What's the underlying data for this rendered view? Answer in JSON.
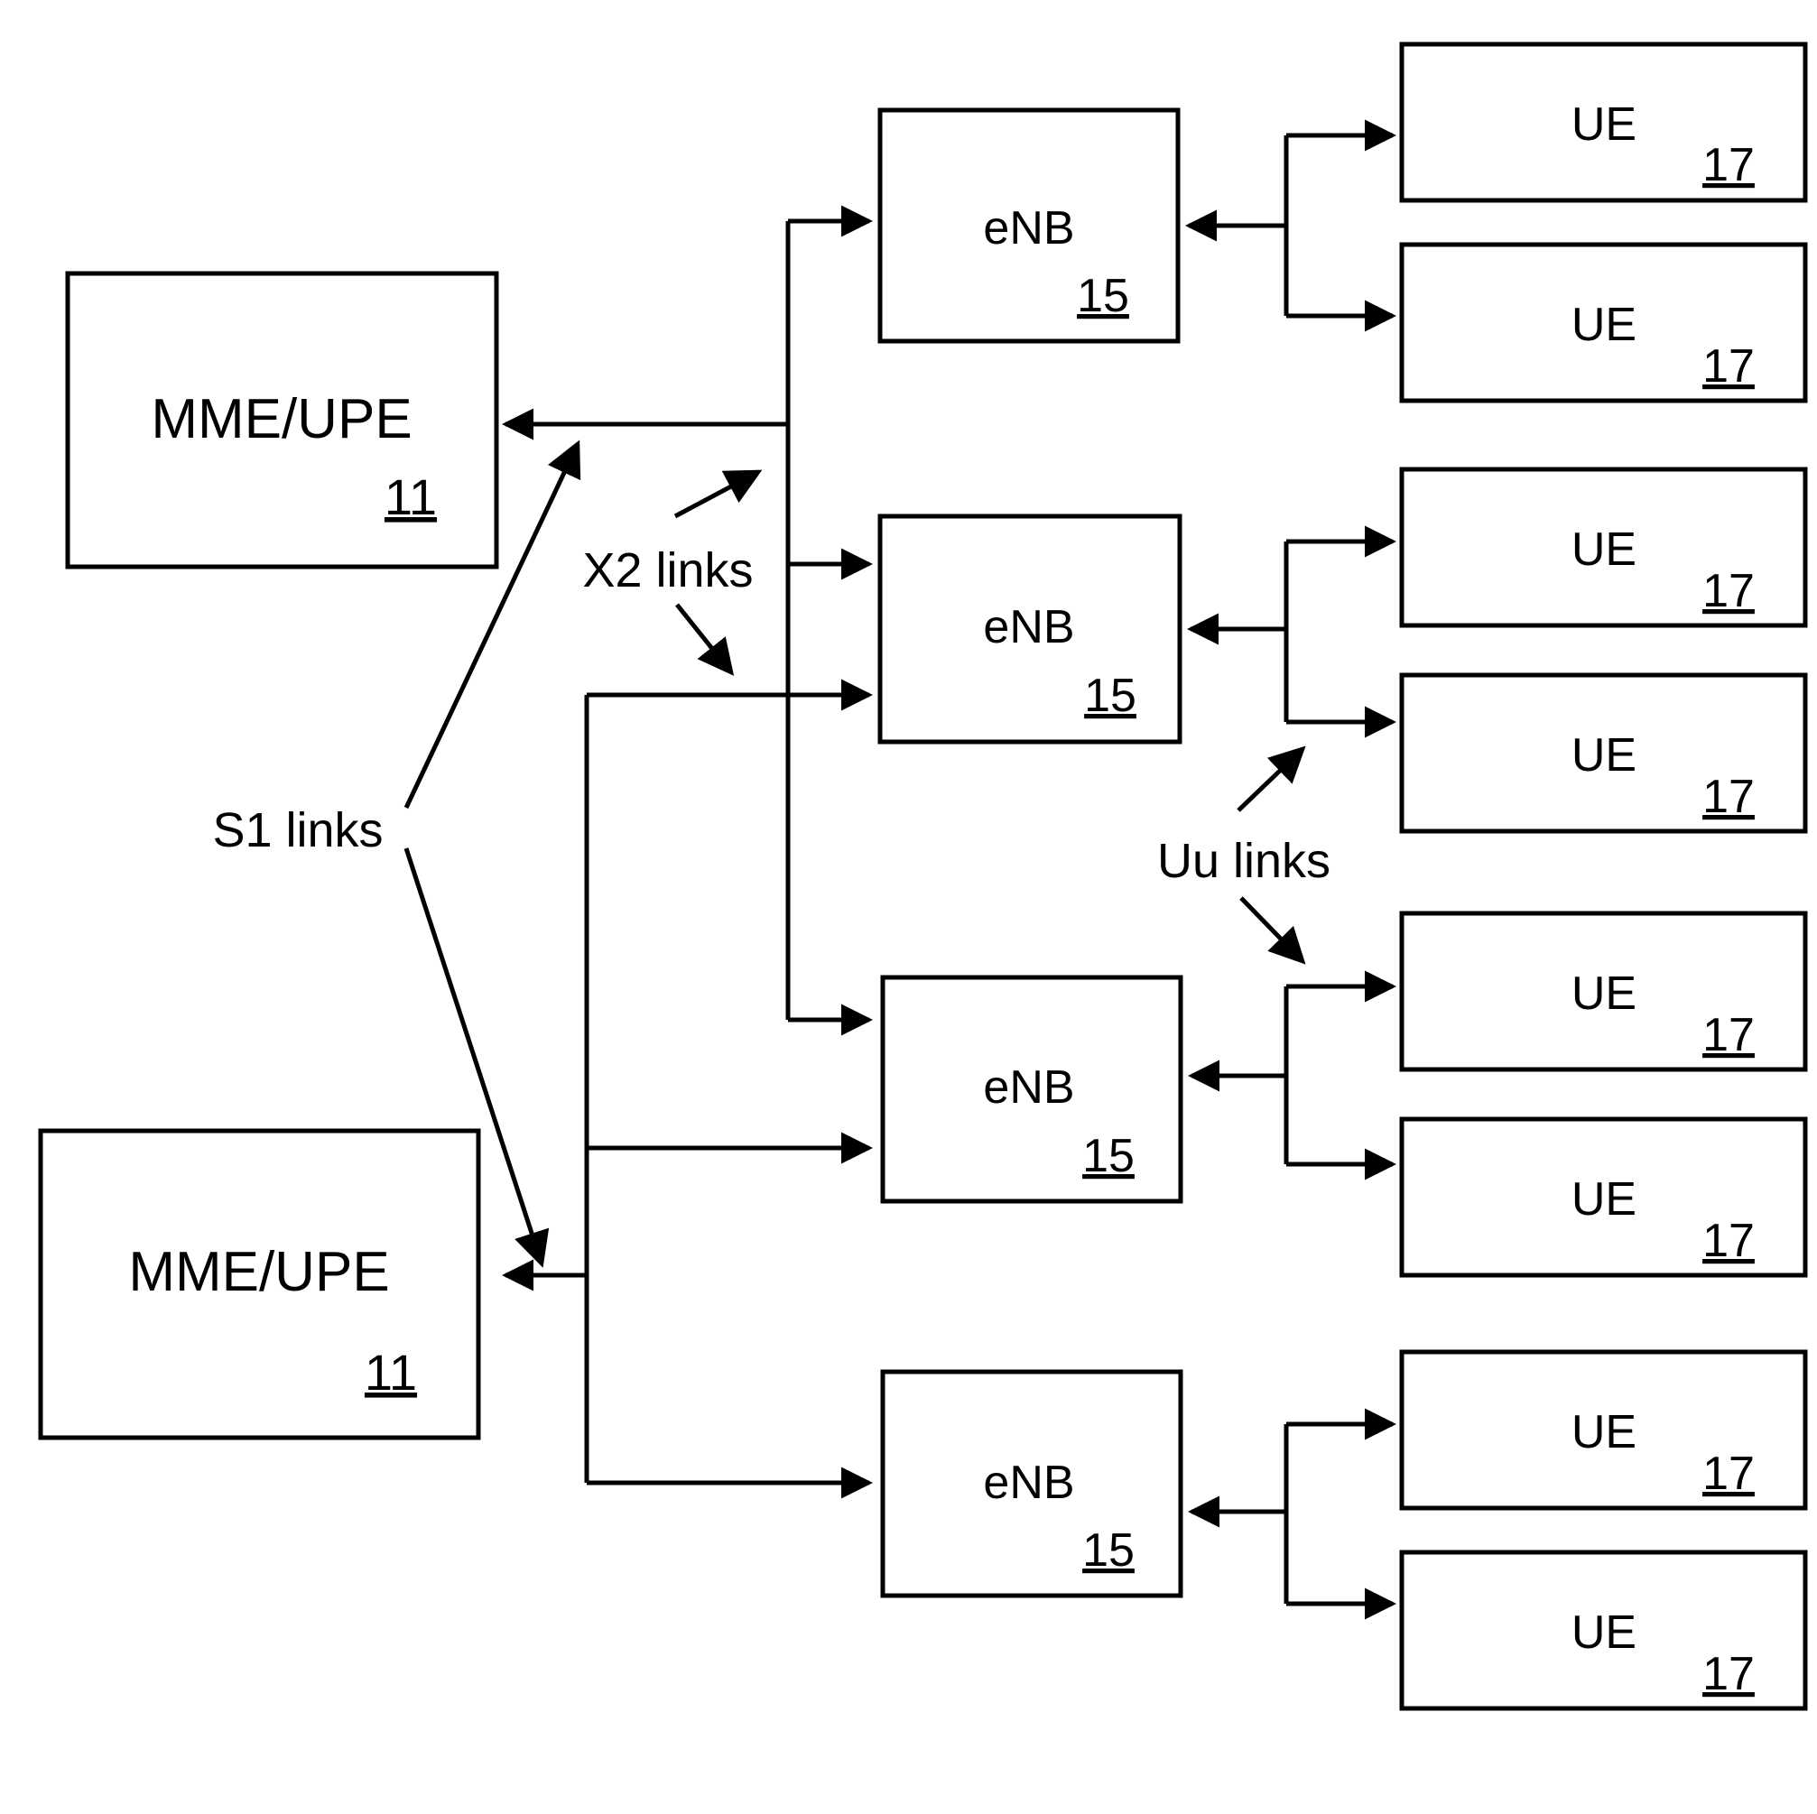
{
  "figure": {
    "type": "network-architecture-block-diagram",
    "description": "LTE network architecture showing two MME/UPE core nodes connected via S1 links to four eNB base stations, which are interconnected via X2 links and connected to user equipment via Uu links."
  },
  "core_nodes": [
    {
      "id": "mme-upe-top",
      "label": "MME/UPE",
      "ref": "11"
    },
    {
      "id": "mme-upe-bottom",
      "label": "MME/UPE",
      "ref": "11"
    }
  ],
  "base_stations": [
    {
      "id": "enb-1",
      "label": "eNB",
      "ref": "15"
    },
    {
      "id": "enb-2",
      "label": "eNB",
      "ref": "15"
    },
    {
      "id": "enb-3",
      "label": "eNB",
      "ref": "15"
    },
    {
      "id": "enb-4",
      "label": "eNB",
      "ref": "15"
    }
  ],
  "user_equipment": [
    {
      "id": "ue-1",
      "label": "UE",
      "ref": "17"
    },
    {
      "id": "ue-2",
      "label": "UE",
      "ref": "17"
    },
    {
      "id": "ue-3",
      "label": "UE",
      "ref": "17"
    },
    {
      "id": "ue-4",
      "label": "UE",
      "ref": "17"
    },
    {
      "id": "ue-5",
      "label": "UE",
      "ref": "17"
    },
    {
      "id": "ue-6",
      "label": "UE",
      "ref": "17"
    },
    {
      "id": "ue-7",
      "label": "UE",
      "ref": "17"
    },
    {
      "id": "ue-8",
      "label": "UE",
      "ref": "17"
    }
  ],
  "link_labels": {
    "x2": "X2 links",
    "s1": "S1 links",
    "uu": "Uu links"
  },
  "colors": {
    "stroke": "#000000",
    "fill": "#ffffff",
    "background": "#ffffff"
  }
}
